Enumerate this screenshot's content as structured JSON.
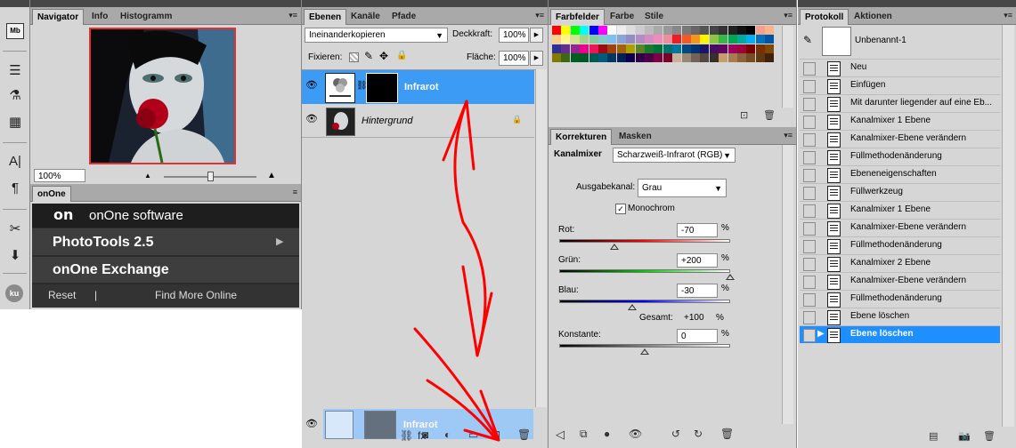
{
  "navigator_panel": {
    "tabs": [
      "Navigator",
      "Info",
      "Histogramm"
    ],
    "zoom_value": "100%"
  },
  "onone_panel": {
    "tab": "onOne",
    "brand": "onOne software",
    "logo_mark": "on",
    "items": [
      {
        "label": "PhotoTools 2.5",
        "arrow": "▶"
      },
      {
        "label": "onOne Exchange",
        "arrow": ""
      }
    ],
    "reset_label": "Reset",
    "separator": "|",
    "find_more_label": "Find More Online"
  },
  "layers_panel": {
    "tabs": [
      "Ebenen",
      "Kanäle",
      "Pfade"
    ],
    "blend_mode": "Ineinanderkopieren",
    "opacity_label": "Deckkraft:",
    "opacity_value": "100%",
    "lock_label": "Fixieren:",
    "fill_label": "Fläche:",
    "fill_value": "100%",
    "layers": [
      {
        "name": "Infrarot",
        "selected": true
      },
      {
        "name": "Hintergrund",
        "selected": false
      }
    ],
    "drag_ghost_label": "Infrarot"
  },
  "swatches_panel": {
    "tabs": [
      "Farbfelder",
      "Farbe",
      "Stile"
    ],
    "colors": [
      "#ff0000",
      "#ffff00",
      "#00ff00",
      "#00ffff",
      "#0000ff",
      "#ff00ff",
      "#ffffff",
      "#eeeeee",
      "#dddddd",
      "#cccccc",
      "#bbbbbb",
      "#aaaaaa",
      "#999999",
      "#888888",
      "#777777",
      "#666666",
      "#555555",
      "#444444",
      "#333333",
      "#222222",
      "#111111",
      "#000000",
      "#f5a08c",
      "#f9b48c",
      "#fdd08c",
      "#fff58c",
      "#d4e48c",
      "#a4d48c",
      "#84cc9c",
      "#80cccc",
      "#80c0f0",
      "#8ca4d8",
      "#948cc4",
      "#b48cc4",
      "#d48cc4",
      "#f08cbc",
      "#f08c9c",
      "#ee1c24",
      "#f15a24",
      "#f7941d",
      "#fff200",
      "#8dc63f",
      "#39b54a",
      "#00a651",
      "#00a99d",
      "#00aeef",
      "#0072bc",
      "#0054a6",
      "#2e3192",
      "#662d91",
      "#92278f",
      "#ec008c",
      "#ed145b",
      "#9e0b0f",
      "#a0410d",
      "#a3620a",
      "#aba000",
      "#598527",
      "#197b30",
      "#007236",
      "#00746b",
      "#0076a3",
      "#004a80",
      "#003471",
      "#1b1464",
      "#440e62",
      "#630460",
      "#9e005d",
      "#9e0039",
      "#790000",
      "#7b2e00",
      "#7d4900",
      "#827b00",
      "#406618",
      "#005e20",
      "#005826",
      "#005952",
      "#005b7f",
      "#003663",
      "#002157",
      "#0d004c",
      "#32004b",
      "#4b0049",
      "#7b0046",
      "#7a0026",
      "#c7b299",
      "#998675",
      "#736357",
      "#534741",
      "#37302a",
      "#c69c6d",
      "#a67c52",
      "#8c6239",
      "#754c24",
      "#603913",
      "#42210b"
    ]
  },
  "corrections_panel": {
    "tabs": [
      "Korrekturen",
      "Masken"
    ],
    "adjustment_name": "Kanalmixer",
    "preset": "Scharzweiß-Infrarot (RGB)",
    "output_label": "Ausgabekanal:",
    "output_value": "Grau",
    "monochrome_label": "Monochrom",
    "monochrome_checked": true,
    "sliders": [
      {
        "name": "Rot",
        "label": "Rot:",
        "value": "-70",
        "unit": "%",
        "level": -70
      },
      {
        "name": "Grün",
        "label": "Grün:",
        "value": "+200",
        "unit": "%",
        "level": 200
      },
      {
        "name": "Blau",
        "label": "Blau:",
        "value": "-30",
        "unit": "%",
        "level": -30
      }
    ],
    "total_label": "Gesamt:",
    "total_value": "+100",
    "total_unit": "%",
    "constant": {
      "label": "Konstante:",
      "value": "0",
      "unit": "%",
      "level": 0
    }
  },
  "history_panel": {
    "tabs": [
      "Protokoll",
      "Aktionen"
    ],
    "snapshot_name": "Unbenannt-1",
    "items": [
      "Neu",
      "Einfügen",
      "Mit darunter liegender auf eine Eb...",
      "Kanalmixer 1 Ebene",
      "Kanalmixer-Ebene verändern",
      "Füllmethodenänderung",
      "Ebeneneigenschaften",
      "Füllwerkzeug",
      "Kanalmixer 1 Ebene",
      "Kanalmixer-Ebene verändern",
      "Füllmethodenänderung",
      "Kanalmixer 2 Ebene",
      "Kanalmixer-Ebene verändern",
      "Füllmethodenänderung",
      "Ebene löschen",
      "Ebene löschen"
    ],
    "selected_index": 15
  },
  "left_toolbar": {
    "avatar_label": "ku",
    "icons": [
      "mini-bridge-icon",
      "adjust-icon",
      "layers-comp-icon",
      "stamp-icon",
      "text-icon",
      "paragraph-icon",
      "tools-icon",
      "clone-icon"
    ]
  },
  "colors": {
    "selection_blue": "#3c9bf5",
    "history_selected": "#1f8fff",
    "annotation_red": "#ff0000",
    "onone_bg": "#2b2b2b"
  }
}
